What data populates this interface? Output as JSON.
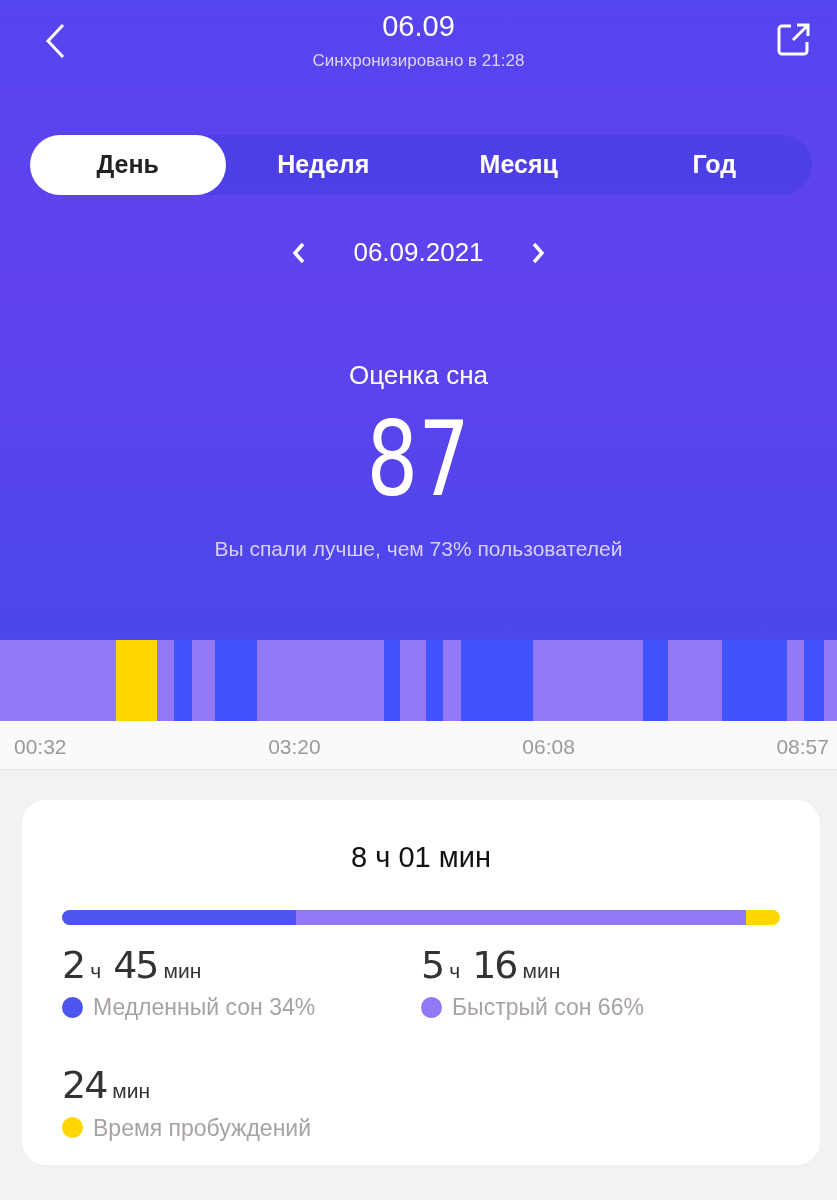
{
  "header": {
    "title": "06.09",
    "subtitle": "Синхронизировано в 21:28"
  },
  "tabs": [
    {
      "label": "День",
      "selected": true
    },
    {
      "label": "Неделя",
      "selected": false
    },
    {
      "label": "Месяц",
      "selected": false
    },
    {
      "label": "Год",
      "selected": false
    }
  ],
  "date_nav": {
    "date": "06.09.2021"
  },
  "score": {
    "label": "Оценка сна",
    "value": "87",
    "comparison": "Вы спали лучше, чем 73% пользователей"
  },
  "timeline": {
    "times": [
      "00:32",
      "03:20",
      "06:08",
      "08:57"
    ]
  },
  "summary": {
    "total": "8 ч 01 мин",
    "segments": [
      {
        "color": "#4e55ef"
      },
      {
        "color": "#9378f5"
      },
      {
        "color": "#ffd600"
      }
    ],
    "stats": [
      {
        "parts": [
          {
            "num": "2",
            "unit": "ч"
          },
          {
            "num": "45",
            "unit": "мин"
          }
        ],
        "label": "Медленный сон 34%",
        "color": "#4e55ef"
      },
      {
        "parts": [
          {
            "num": "5",
            "unit": "ч"
          },
          {
            "num": "16",
            "unit": "мин"
          }
        ],
        "label": "Быстрый сон 66%",
        "color": "#9378f5"
      },
      {
        "parts": [
          {
            "num": "24",
            "unit": "мин"
          }
        ],
        "label": "Время пробуждений",
        "color": "#ffd600"
      }
    ]
  }
}
